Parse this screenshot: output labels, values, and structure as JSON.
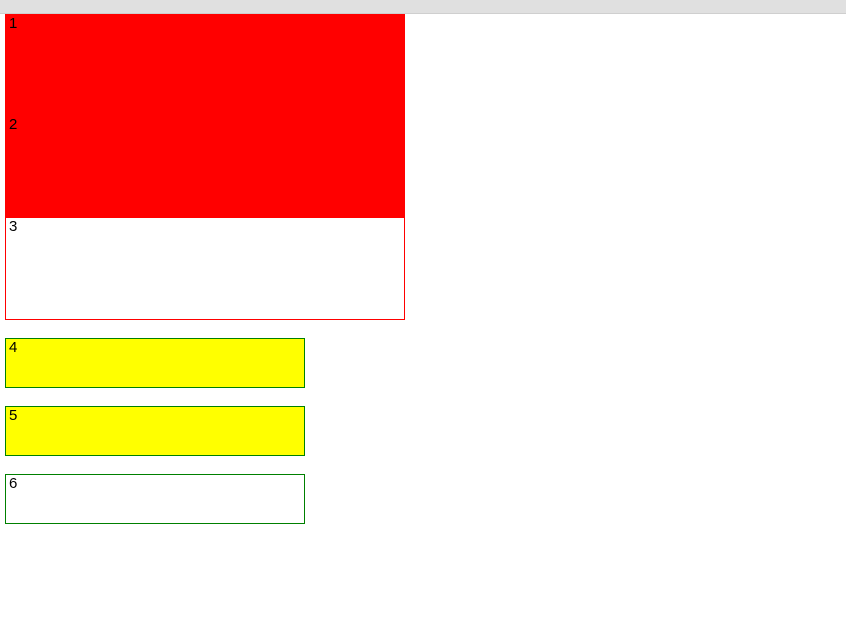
{
  "boxes": {
    "b1": "1",
    "b2": "2",
    "b3": "3",
    "b4": "4",
    "b5": "5",
    "b6": "6"
  }
}
